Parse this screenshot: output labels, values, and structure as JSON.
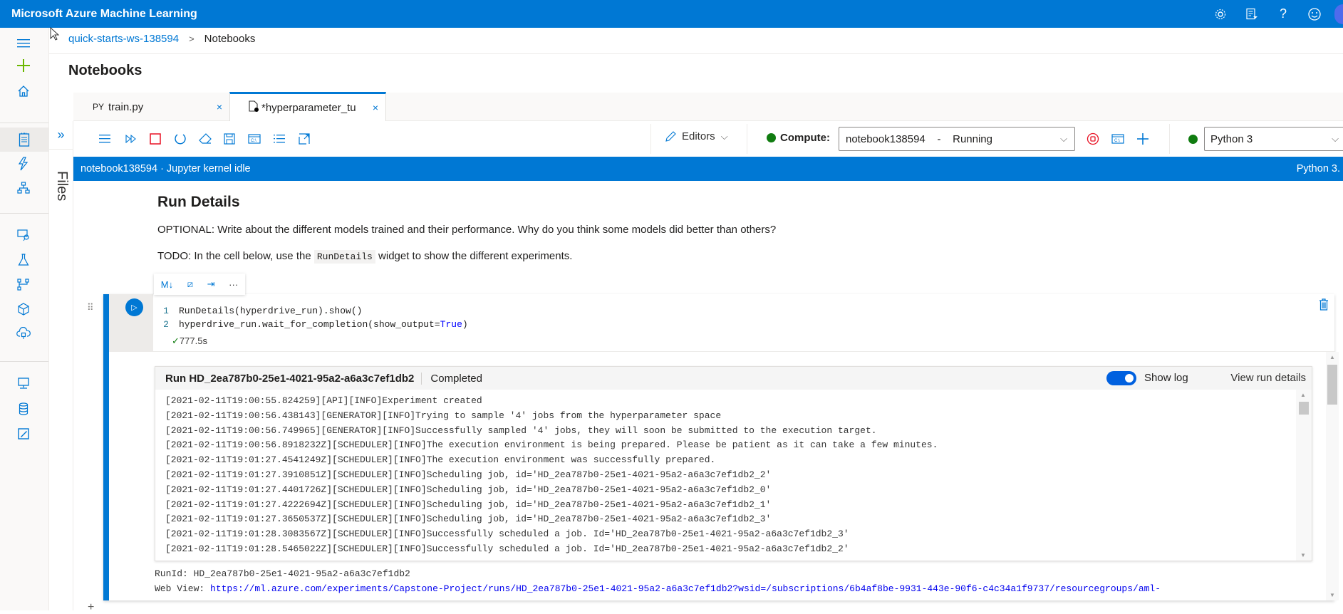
{
  "app": {
    "title": "Microsoft Azure Machine Learning",
    "top_icons": [
      "settings-icon",
      "feedback-filter-icon",
      "help-icon",
      "smiley-icon"
    ]
  },
  "breadcrumb": {
    "workspace": "quick-starts-ws-138594",
    "separator": ">",
    "current": "Notebooks"
  },
  "page": {
    "title": "Notebooks"
  },
  "files_panel": {
    "label": "Files",
    "toggle": "»"
  },
  "tabs": [
    {
      "prefix": "PY",
      "label": "train.py",
      "close": "×"
    },
    {
      "label": "*hyperparameter_tu",
      "close": "×",
      "active": true
    }
  ],
  "toolbar": {
    "editors_label": "Editors",
    "compute_label": "Compute:",
    "compute_value": "notebook138594    -    Running",
    "kernel_value": "Python 3",
    "chevron": "⌵"
  },
  "kernel_status": {
    "left": "notebook138594 · Jupyter kernel idle",
    "right": "Python 3."
  },
  "markdown": {
    "title": "Run Details",
    "optional": "OPTIONAL: Write about the different models trained and their performance. Why do you think some models did better than others?",
    "todo_before": "TODO: In the cell below, use the ",
    "todo_code": "RunDetails",
    "todo_after": " widget to show the different experiments."
  },
  "cell_toolbar": [
    "M↓",
    "⧄",
    "⇥",
    "···"
  ],
  "cell": {
    "lines": [
      {
        "n": "1",
        "code": "RunDetails(hyperdrive_run).show()"
      },
      {
        "n": "2",
        "code_before": "hyperdrive_run.wait_for_completion(show_output=",
        "keyword": "True",
        "code_after": ")"
      }
    ],
    "exec_check": "✓",
    "exec_time": "777.5s"
  },
  "widget": {
    "run_name": "Run HD_2ea787b0-25e1-4021-95a2-a6a3c7ef1db2",
    "status": "Completed",
    "show_log_label": "Show log",
    "show_log_on": true,
    "view_details_label": "View run details",
    "log_lines": [
      "[2021-02-11T19:00:55.824259][API][INFO]Experiment created",
      "[2021-02-11T19:00:56.438143][GENERATOR][INFO]Trying to sample '4' jobs from the hyperparameter space",
      "[2021-02-11T19:00:56.749965][GENERATOR][INFO]Successfully sampled '4' jobs, they will soon be submitted to the execution target.",
      "[2021-02-11T19:00:56.8918232Z][SCHEDULER][INFO]The execution environment is being prepared. Please be patient as it can take a few minutes.",
      "[2021-02-11T19:01:27.4541249Z][SCHEDULER][INFO]The execution environment was successfully prepared.",
      "[2021-02-11T19:01:27.3910851Z][SCHEDULER][INFO]Scheduling job, id='HD_2ea787b0-25e1-4021-95a2-a6a3c7ef1db2_2'",
      "[2021-02-11T19:01:27.4401726Z][SCHEDULER][INFO]Scheduling job, id='HD_2ea787b0-25e1-4021-95a2-a6a3c7ef1db2_0'",
      "[2021-02-11T19:01:27.4222694Z][SCHEDULER][INFO]Scheduling job, id='HD_2ea787b0-25e1-4021-95a2-a6a3c7ef1db2_1'",
      "[2021-02-11T19:01:27.3650537Z][SCHEDULER][INFO]Scheduling job, id='HD_2ea787b0-25e1-4021-95a2-a6a3c7ef1db2_3'",
      "[2021-02-11T19:01:28.3083567Z][SCHEDULER][INFO]Successfully scheduled a job. Id='HD_2ea787b0-25e1-4021-95a2-a6a3c7ef1db2_3'",
      "[2021-02-11T19:01:28.5465022Z][SCHEDULER][INFO]Successfully scheduled a job. Id='HD_2ea787b0-25e1-4021-95a2-a6a3c7ef1db2_2'"
    ]
  },
  "output": {
    "runid_line": "RunId: HD_2ea787b0-25e1-4021-95a2-a6a3c7ef1db2",
    "webview_label": "Web View: ",
    "webview_url": "https://ml.azure.com/experiments/Capstone-Project/runs/HD_2ea787b0-25e1-4021-95a2-a6a3c7ef1db2?wsid=/subscriptions/6b4af8be-9931-443e-90f6-c4c34a1f9737/resourcegroups/aml-"
  },
  "colors": {
    "brand": "#0078d4",
    "running": "#107c10",
    "stop": "#e81123"
  }
}
